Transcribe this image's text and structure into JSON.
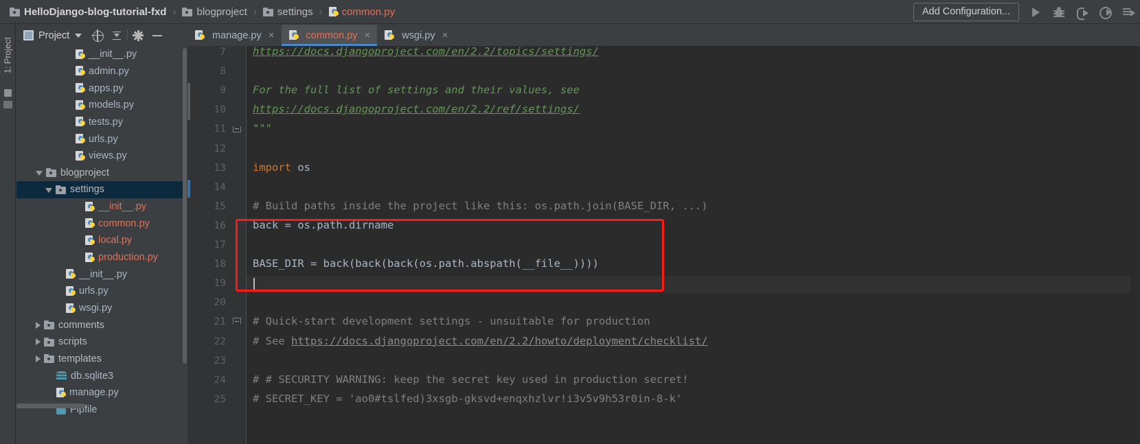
{
  "window": {
    "breadcrumb": [
      {
        "label": "HelloDjango-blog-tutorial-fxd",
        "icon": "folder-icon",
        "kind": "root"
      },
      {
        "label": "blogproject",
        "icon": "folder-icon",
        "kind": "folder"
      },
      {
        "label": "settings",
        "icon": "folder-icon",
        "kind": "folder"
      },
      {
        "label": "common.py",
        "icon": "python-file-icon",
        "kind": "python"
      }
    ],
    "separator": "›"
  },
  "toolbar": {
    "add_configuration_label": "Add Configuration...",
    "icons": [
      {
        "name": "run-icon"
      },
      {
        "name": "debug-icon"
      },
      {
        "name": "run-coverage-icon"
      },
      {
        "name": "profile-icon"
      },
      {
        "name": "more-run-options-icon"
      }
    ]
  },
  "left_strip": {
    "project_tab_label": "1: Project"
  },
  "project_panel": {
    "title": "Project",
    "buttons": [
      {
        "name": "select-opened-file-icon"
      },
      {
        "name": "collapse-all-icon"
      },
      {
        "name": "settings-gear-icon"
      },
      {
        "name": "hide-panel-icon"
      }
    ],
    "tree": [
      {
        "label": "__init__.py",
        "indent": 5,
        "arrow": "none",
        "icon": "python-file-icon",
        "color": "blue",
        "selected": false
      },
      {
        "label": "admin.py",
        "indent": 5,
        "arrow": "none",
        "icon": "python-file-icon",
        "color": "blue",
        "selected": false
      },
      {
        "label": "apps.py",
        "indent": 5,
        "arrow": "none",
        "icon": "python-file-icon",
        "color": "blue",
        "selected": false
      },
      {
        "label": "models.py",
        "indent": 5,
        "arrow": "none",
        "icon": "python-file-icon",
        "color": "blue",
        "selected": false
      },
      {
        "label": "tests.py",
        "indent": 5,
        "arrow": "none",
        "icon": "python-file-icon",
        "color": "blue",
        "selected": false
      },
      {
        "label": "urls.py",
        "indent": 5,
        "arrow": "none",
        "icon": "python-file-icon",
        "color": "blue",
        "selected": false
      },
      {
        "label": "views.py",
        "indent": 5,
        "arrow": "none",
        "icon": "python-file-icon",
        "color": "blue",
        "selected": false
      },
      {
        "label": "blogproject",
        "indent": 2,
        "arrow": "down",
        "icon": "folder-icon",
        "color": "plain",
        "selected": false
      },
      {
        "label": "settings",
        "indent": 3,
        "arrow": "down",
        "icon": "folder-icon",
        "color": "plain",
        "selected": true
      },
      {
        "label": "__init__.py",
        "indent": 6,
        "arrow": "none",
        "icon": "python-file-icon",
        "color": "red",
        "selected": false
      },
      {
        "label": "common.py",
        "indent": 6,
        "arrow": "none",
        "icon": "python-file-icon",
        "color": "red",
        "selected": false
      },
      {
        "label": "local.py",
        "indent": 6,
        "arrow": "none",
        "icon": "python-file-icon",
        "color": "red",
        "selected": false
      },
      {
        "label": "production.py",
        "indent": 6,
        "arrow": "none",
        "icon": "python-file-icon",
        "color": "red",
        "selected": false
      },
      {
        "label": "__init__.py",
        "indent": 4,
        "arrow": "none",
        "icon": "python-file-icon",
        "color": "blue",
        "selected": false
      },
      {
        "label": "urls.py",
        "indent": 4,
        "arrow": "none",
        "icon": "python-file-icon",
        "color": "blue",
        "selected": false
      },
      {
        "label": "wsgi.py",
        "indent": 4,
        "arrow": "none",
        "icon": "python-file-icon",
        "color": "blue",
        "selected": false
      },
      {
        "label": "comments",
        "indent": 2,
        "arrow": "right",
        "icon": "folder-icon",
        "color": "plain",
        "selected": false
      },
      {
        "label": "scripts",
        "indent": 2,
        "arrow": "right",
        "icon": "folder-icon",
        "color": "plain",
        "selected": false
      },
      {
        "label": "templates",
        "indent": 2,
        "arrow": "right",
        "icon": "folder-icon",
        "color": "plain",
        "selected": false
      },
      {
        "label": "db.sqlite3",
        "indent": 3,
        "arrow": "none",
        "icon": "database-icon",
        "color": "blue",
        "selected": false
      },
      {
        "label": "manage.py",
        "indent": 3,
        "arrow": "none",
        "icon": "python-file-icon",
        "color": "blue",
        "selected": false
      },
      {
        "label": "Pipfile",
        "indent": 3,
        "arrow": "none",
        "icon": "pipfile-icon",
        "color": "blue",
        "selected": false
      }
    ]
  },
  "editor_tabs": [
    {
      "label": "manage.py",
      "active": false,
      "color": "blue"
    },
    {
      "label": "common.py",
      "active": true,
      "color": "red"
    },
    {
      "label": "wsgi.py",
      "active": false,
      "color": "blue"
    }
  ],
  "editor": {
    "first_visible_line": 7,
    "caret_line": 19,
    "highlight_lines": [
      16,
      19
    ],
    "lines": [
      {
        "n": 7,
        "segs": [
          {
            "t": "https://docs.djangoproject.com/en/2.2/topics/settings/",
            "c": "doclink"
          }
        ]
      },
      {
        "n": 8,
        "segs": []
      },
      {
        "n": 9,
        "segs": [
          {
            "t": "For the full list of settings and their values, see",
            "c": "doc"
          }
        ]
      },
      {
        "n": 10,
        "segs": [
          {
            "t": "https://docs.djangoproject.com/en/2.2/ref/settings/",
            "c": "doclink"
          }
        ]
      },
      {
        "n": 11,
        "segs": [
          {
            "t": "\"\"\"",
            "c": "doc"
          }
        ],
        "fold": "bottom"
      },
      {
        "n": 12,
        "segs": []
      },
      {
        "n": 13,
        "segs": [
          {
            "t": "import",
            "c": "kw"
          },
          {
            "t": " os",
            "c": "id"
          }
        ]
      },
      {
        "n": 14,
        "segs": []
      },
      {
        "n": 15,
        "segs": [
          {
            "t": "# Build paths inside the project like this: os.path.join(BASE_DIR, ...)",
            "c": "cm"
          }
        ]
      },
      {
        "n": 16,
        "segs": [
          {
            "t": "back = os.path.dirname",
            "c": "id"
          }
        ]
      },
      {
        "n": 17,
        "segs": []
      },
      {
        "n": 18,
        "segs": [
          {
            "t": "BASE_DIR = back(back(back(os.path.abspath(__file__))))",
            "c": "id"
          }
        ]
      },
      {
        "n": 19,
        "segs": []
      },
      {
        "n": 20,
        "segs": []
      },
      {
        "n": 21,
        "segs": [
          {
            "t": "# Quick-start development settings - unsuitable for production",
            "c": "cm"
          }
        ],
        "fold": "top"
      },
      {
        "n": 22,
        "segs": [
          {
            "t": "# See ",
            "c": "cm"
          },
          {
            "t": "https://docs.djangoproject.com/en/2.2/howto/deployment/checklist/",
            "c": "lnk"
          }
        ]
      },
      {
        "n": 23,
        "segs": []
      },
      {
        "n": 24,
        "segs": [
          {
            "t": "# # SECURITY WARNING: keep the secret key used in production secret!",
            "c": "cm"
          }
        ]
      },
      {
        "n": 25,
        "segs": [
          {
            "t": "# SECRET_KEY = 'ao0#tslfed)3xsgb-gksvd+enqxhzlvr!i3v5v9h53r0in-8-k'",
            "c": "cm"
          }
        ]
      }
    ]
  },
  "colors": {
    "panel_bg": "#3c3f41",
    "editor_bg": "#2b2b2b",
    "gutter_bg": "#313335",
    "selection_blue": "#0d293e",
    "tab_active": "#4e5254",
    "tab_underline": "#4a88c7",
    "highlight_red": "#ff1a1a",
    "comment_grey": "#808080",
    "docstring_green": "#629755",
    "keyword_orange": "#cc7832",
    "identifier": "#a9b7c6",
    "file_red": "#e0715a"
  }
}
